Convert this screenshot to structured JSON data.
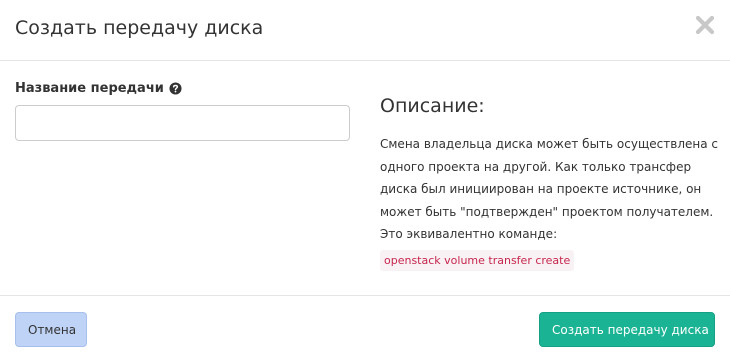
{
  "header": {
    "title": "Создать передачу диска",
    "close_icon": "close-icon"
  },
  "form": {
    "name_label": "Название передачи",
    "help_icon": "question-circle-icon",
    "name_value": "",
    "name_placeholder": ""
  },
  "description": {
    "heading": "Описание:",
    "text": "Смена владельца диска может быть осуществлена с одного проекта на другой. Как только трансфер диска был инициирован на проекте источнике, он может быть \"подтвержден\" проектом получателем. Это эквивалентно команде:",
    "command": "openstack volume transfer create"
  },
  "footer": {
    "cancel_label": "Отмена",
    "submit_label": "Создать передачу диска"
  },
  "colors": {
    "submit_bg": "#1ab394",
    "cancel_bg": "#bfd3f6",
    "code_text": "#c7254e",
    "code_bg": "#f9f2f4"
  }
}
